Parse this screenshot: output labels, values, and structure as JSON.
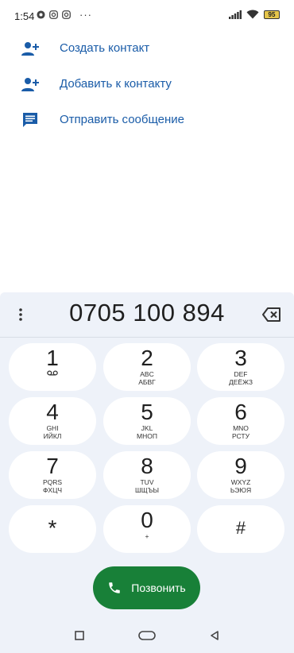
{
  "status_bar": {
    "time": "1:54",
    "battery": "95",
    "icons": [
      "chrome-icon",
      "instagram-icon",
      "instagram-icon",
      "more-dots-icon",
      "signal-icon",
      "wifi-icon",
      "battery-icon"
    ]
  },
  "actions": [
    {
      "label": "Создать контакт",
      "icon": "add-person-icon"
    },
    {
      "label": "Добавить к контакту",
      "icon": "add-person-icon"
    },
    {
      "label": "Отправить сообщение",
      "icon": "message-icon"
    }
  ],
  "dialer": {
    "number": "0705 100 894",
    "keys": [
      {
        "digit": "1",
        "sub": "",
        "icon": "voicemail-icon"
      },
      {
        "digit": "2",
        "sub": "ABC\nАБВГ"
      },
      {
        "digit": "3",
        "sub": "DEF\nДЕЁЖЗ"
      },
      {
        "digit": "4",
        "sub": "GHI\nИЙКЛ"
      },
      {
        "digit": "5",
        "sub": "JKL\nМНОП"
      },
      {
        "digit": "6",
        "sub": "MNO\nРСТУ"
      },
      {
        "digit": "7",
        "sub": "PQRS\nФХЦЧ"
      },
      {
        "digit": "8",
        "sub": "TUV\nШЩЪЫ"
      },
      {
        "digit": "9",
        "sub": "WXYZ\nЬЭЮЯ"
      },
      {
        "digit": "*",
        "sub": ""
      },
      {
        "digit": "0",
        "sub": "+"
      },
      {
        "digit": "#",
        "sub": ""
      }
    ],
    "call_label": "Позвонить"
  },
  "colors": {
    "accent": "#1a5ca8",
    "call": "#188038",
    "panel": "#eef2f9"
  }
}
